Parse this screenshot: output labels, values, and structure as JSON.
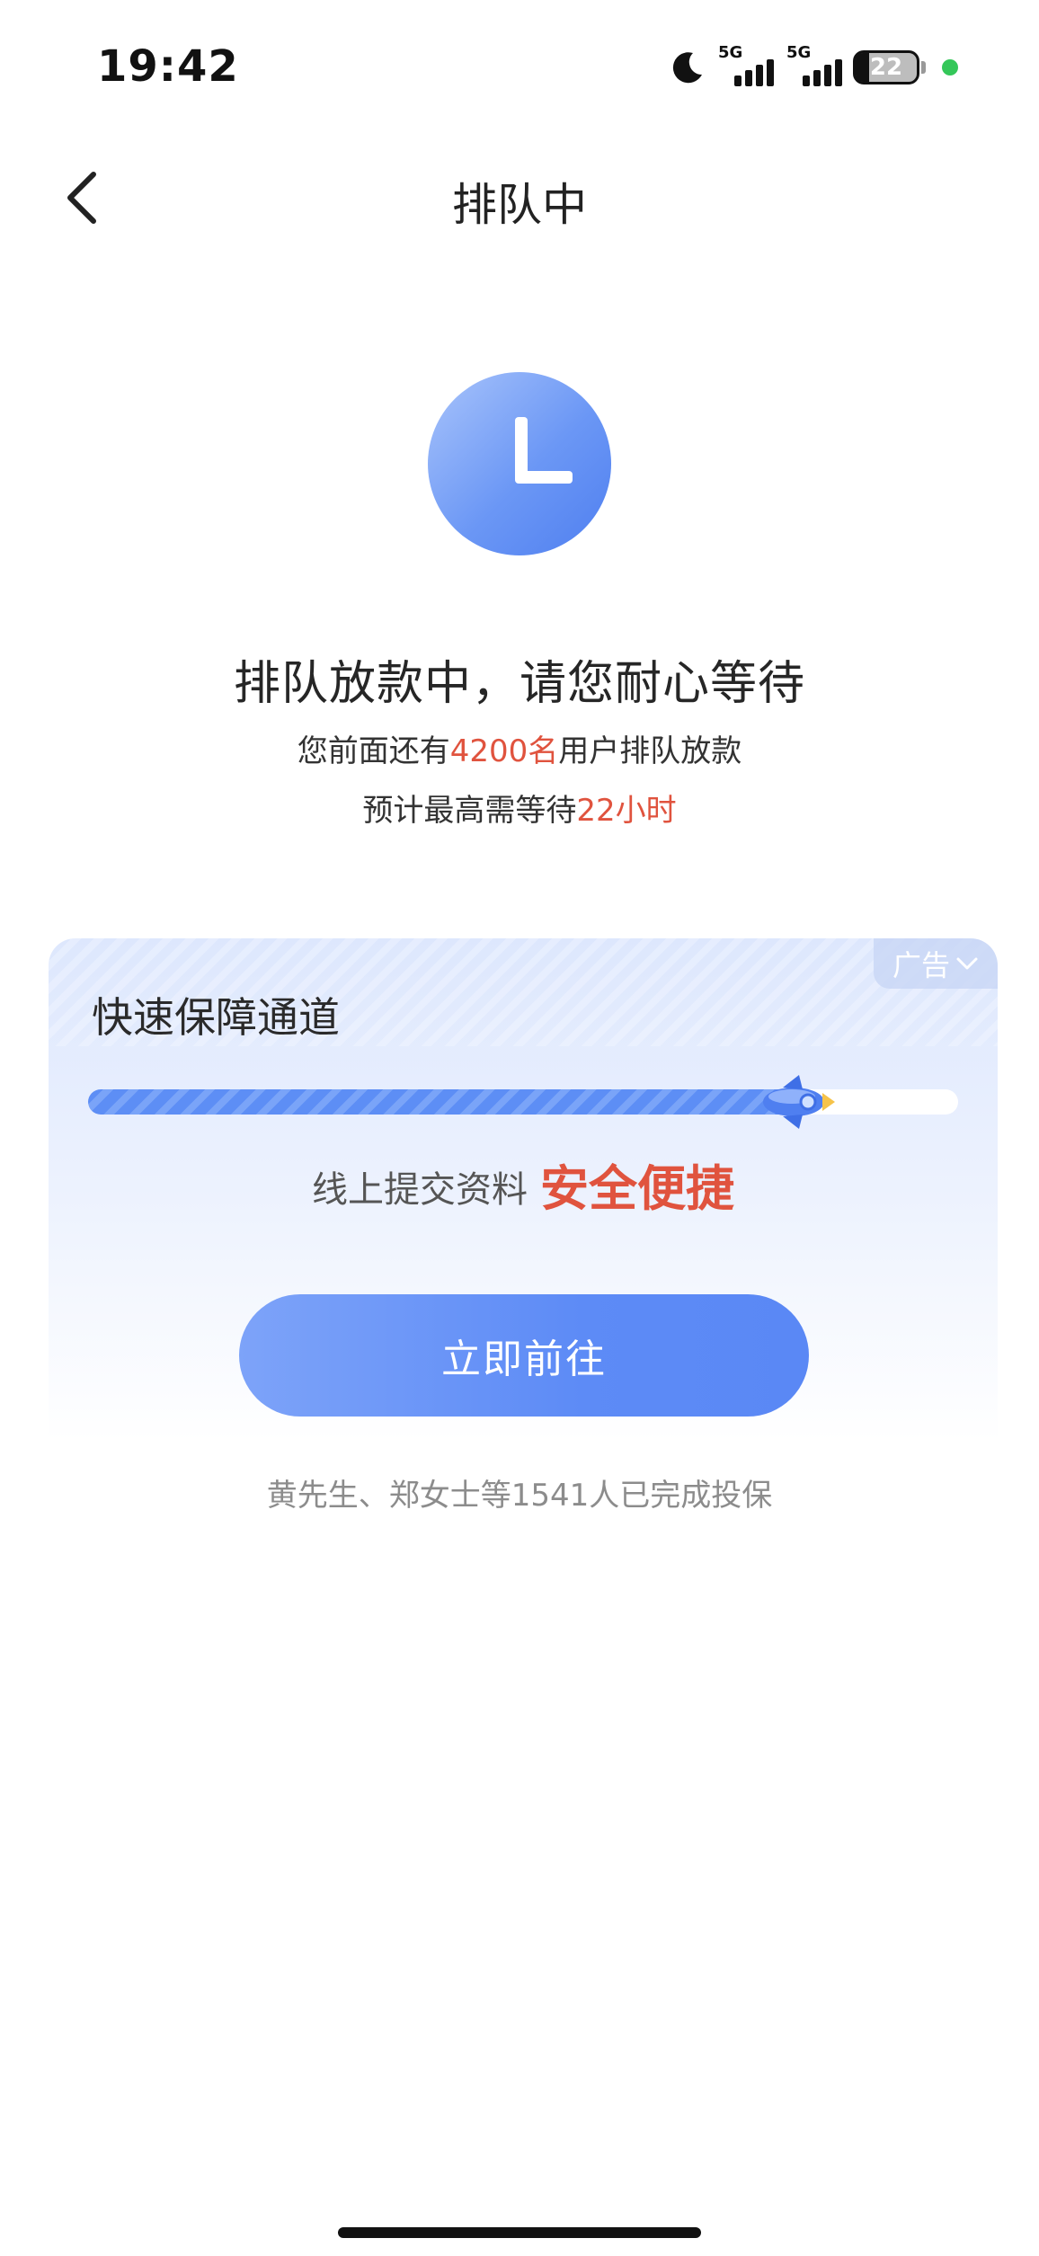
{
  "status_bar": {
    "time": "19:42",
    "sim1_network": "5G",
    "sim2_network": "5G",
    "battery_level": "22",
    "icons": [
      "moon-icon",
      "signal-icon",
      "signal-icon",
      "battery-icon",
      "camera-indicator-dot"
    ],
    "indicator_color": "#34c759"
  },
  "nav": {
    "title": "排队中",
    "back_icon": "chevron-left-icon"
  },
  "status": {
    "icon": "clock-icon",
    "headline": "排队放款中，请您耐心等待",
    "line1_prefix": "您前面还有",
    "line1_count": "4200名",
    "line1_suffix": "用户排队放款",
    "line2_prefix": "预计最高需等待",
    "line2_time": "22小时",
    "highlight_color": "#e0533e"
  },
  "ad_card": {
    "ad_tag": "广告",
    "title": "快速保障通道",
    "progress": 0.83,
    "slogan_prefix": "线上提交资料",
    "slogan_highlight": "安全便捷",
    "button_label": "立即前往",
    "accent_color": "#5d8ef5"
  },
  "footer": {
    "note": "黄先生、郑女士等1541人已完成投保"
  }
}
